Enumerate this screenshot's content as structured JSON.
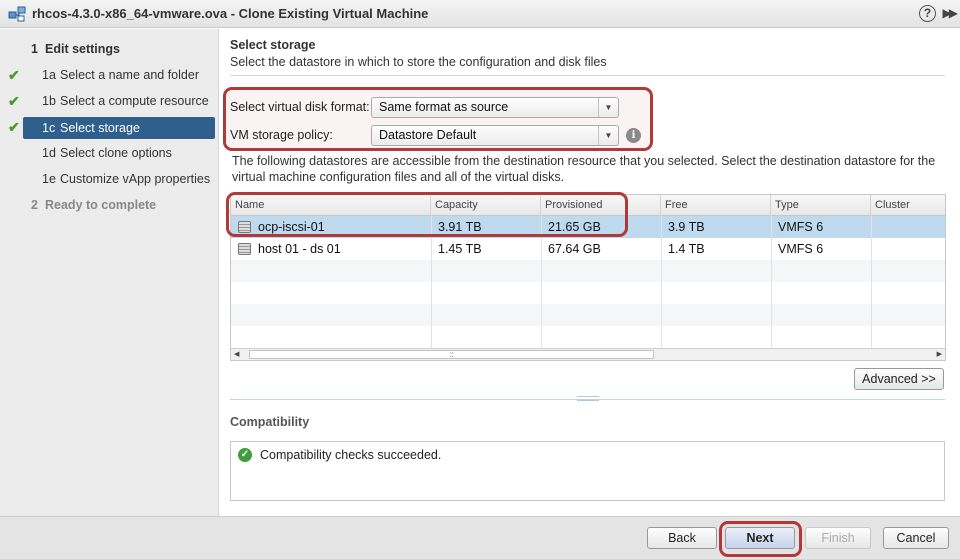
{
  "window": {
    "title": "rhcos-4.3.0-x86_64-vmware.ova - Clone Existing Virtual Machine",
    "help_label": "?",
    "expand_label": "▶▶"
  },
  "nav": {
    "items": [
      {
        "number": "1",
        "label": "Edit settings",
        "state": "section",
        "checked": false
      },
      {
        "number": "1a",
        "label": "Select a name and folder",
        "state": "done",
        "checked": true
      },
      {
        "number": "1b",
        "label": "Select a compute resource",
        "state": "done",
        "checked": true
      },
      {
        "number": "1c",
        "label": "Select storage",
        "state": "current",
        "checked": true
      },
      {
        "number": "1d",
        "label": "Select clone options",
        "state": "pending",
        "checked": false
      },
      {
        "number": "1e",
        "label": "Customize vApp properties",
        "state": "pending",
        "checked": false
      },
      {
        "number": "2",
        "label": "Ready to complete",
        "state": "disabled",
        "checked": false
      }
    ],
    "check_glyph": "✔"
  },
  "main": {
    "title": "Select storage",
    "description": "Select the datastore in which to store the configuration and disk files",
    "disk_format": {
      "label": "Select virtual disk format:",
      "value": "Same format as source"
    },
    "storage_policy": {
      "label": "VM storage policy:",
      "value": "Datastore Default",
      "info_glyph": "i"
    },
    "datastores_desc": "The following datastores are accessible from the destination resource that you selected. Select the destination datastore for the virtual machine configuration files and all of the virtual disks.",
    "table": {
      "columns": [
        "Name",
        "Capacity",
        "Provisioned",
        "Free",
        "Type",
        "Cluster"
      ],
      "rows": [
        {
          "name": "ocp-iscsi-01",
          "capacity": "3.91 TB",
          "provisioned": "21.65 GB",
          "free": "3.9 TB",
          "type": "VMFS 6",
          "cluster": "",
          "selected": true
        },
        {
          "name": "host 01 - ds 01",
          "capacity": "1.45 TB",
          "provisioned": "67.64 GB",
          "free": "1.4 TB",
          "type": "VMFS 6",
          "cluster": "",
          "selected": false
        }
      ],
      "scroll_grip": "::"
    },
    "advanced_label": "Advanced >>",
    "compatibility": {
      "title": "Compatibility",
      "message": "Compatibility checks succeeded.",
      "ok_glyph": "✓"
    }
  },
  "footer": {
    "back_label": "Back",
    "next_label": "Next",
    "finish_label": "Finish",
    "cancel_label": "Cancel"
  },
  "colors": {
    "nav_selected": "#2f5f8c",
    "highlight": "#b03a3a",
    "row_selected": "#bfd9ef",
    "check": "#4b9a2a"
  }
}
